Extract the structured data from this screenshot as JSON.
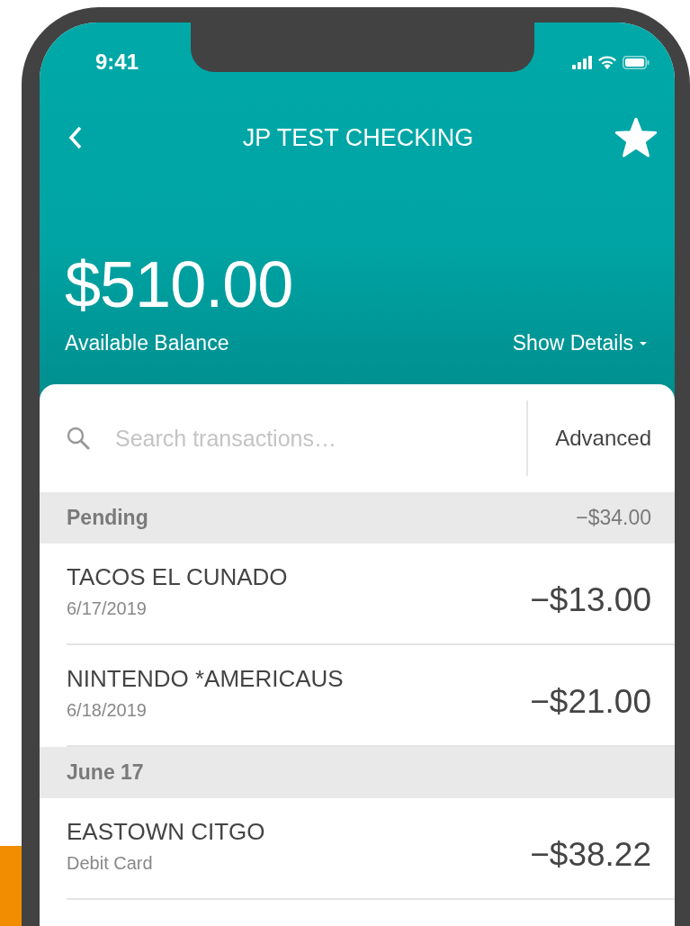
{
  "status_bar": {
    "time": "9:41"
  },
  "header": {
    "title": "JP TEST CHECKING",
    "favorite": true
  },
  "balance": {
    "amount": "$510.00",
    "label": "Available Balance",
    "details_link": "Show Details"
  },
  "search": {
    "placeholder": "Search transactions…",
    "advanced": "Advanced"
  },
  "sections": [
    {
      "label": "Pending",
      "total": "−$34.00",
      "transactions": [
        {
          "name": "TACOS EL CUNADO",
          "detail": "6/17/2019",
          "amount": "−$13.00"
        },
        {
          "name": "NINTENDO *AMERICAUS",
          "detail": "6/18/2019",
          "amount": "−$21.00"
        }
      ]
    },
    {
      "label": "June 17",
      "transactions": [
        {
          "name": "EASTOWN CITGO",
          "detail": "Debit Card",
          "amount": "−$38.22"
        }
      ]
    }
  ]
}
